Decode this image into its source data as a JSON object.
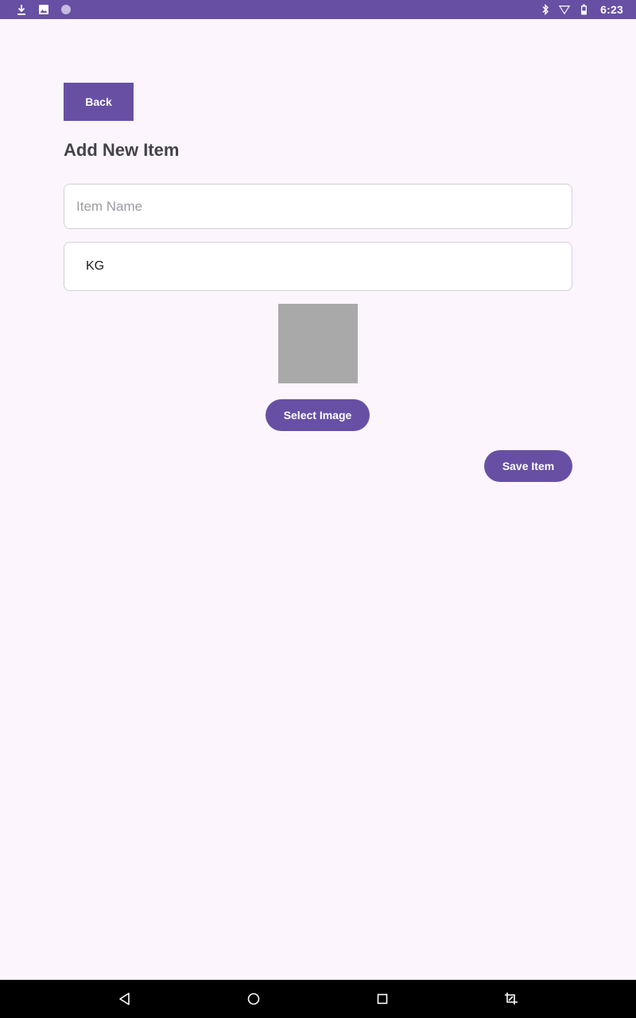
{
  "status_bar": {
    "time": "6:23",
    "left_icons": [
      "download-icon",
      "image-icon",
      "circle-icon"
    ],
    "right_icons": [
      "bluetooth-icon",
      "wifi-icon",
      "battery-icon"
    ]
  },
  "header": {
    "back_label": "Back",
    "title": "Add New Item"
  },
  "form": {
    "item_name_placeholder": "Item Name",
    "item_name_value": "",
    "unit_value": "KG",
    "select_image_label": "Select Image",
    "save_label": "Save Item"
  },
  "nav_bar": {
    "buttons": [
      "back-nav-icon",
      "home-nav-icon",
      "recents-nav-icon",
      "screenshot-nav-icon"
    ]
  },
  "colors": {
    "accent": "#6750a4",
    "background": "#fcf5fd",
    "image_placeholder": "#a9a9a9"
  }
}
